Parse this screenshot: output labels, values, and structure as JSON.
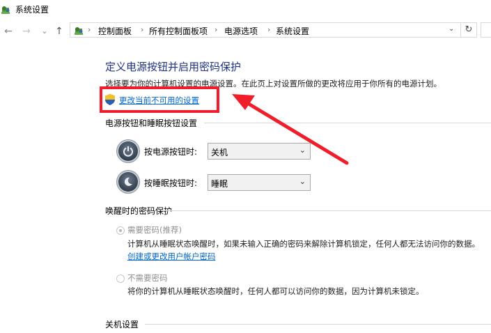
{
  "window": {
    "title": "系统设置"
  },
  "breadcrumb": {
    "items": [
      "控制面板",
      "所有控制面板项",
      "电源选项",
      "系统设置"
    ]
  },
  "nav": {
    "back": "←",
    "forward": "→",
    "recent": "⌄",
    "up": "↑",
    "refresh": "↻",
    "dropdown": "⌄"
  },
  "main": {
    "heading": "定义电源按钮并启用密码保护",
    "description": "选择要为你的计算机设置的电源设置。在此页上对设置所做的更改将应用于你所有的电源计划。",
    "change_link": "更改当前不可用的设置",
    "buttons_section": {
      "title": "电源按钮和睡眠按钮设置",
      "power_label": "按电源按钮时:",
      "power_value": "关机",
      "sleep_label": "按睡眠按钮时:",
      "sleep_value": "睡眠"
    },
    "wake_section": {
      "title": "唤醒时的密码保护",
      "require_label": "需要密码(推荐)",
      "require_desc": "计算机从睡眠状态唤醒时，如果未输入正确的密码来解除计算机锁定，任何人都无法访问你的数据。",
      "require_link": "创建或更改用户帐户密码",
      "no_require_label": "不需要密码",
      "no_require_desc": "将你的计算机从睡眠状态唤醒时，任何人都可以访问你的数据，因为计算机未锁定。"
    },
    "shutdown_section": {
      "title": "关机设置"
    }
  },
  "colors": {
    "heading": "#1e3287",
    "link": "#0066cc",
    "highlight": "#ef1e2a"
  }
}
